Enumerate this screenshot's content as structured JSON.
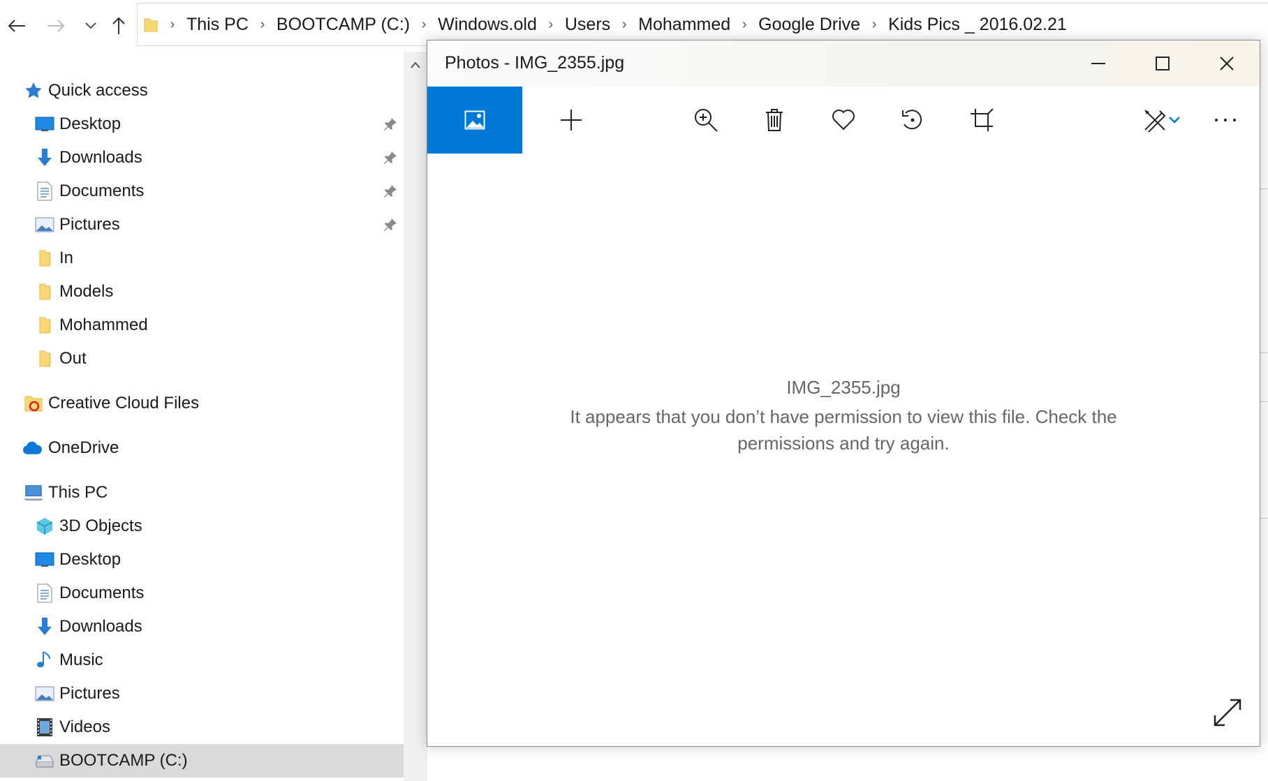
{
  "address_bar": {
    "crumbs": [
      "This PC",
      "BOOTCAMP (C:)",
      "Windows.old",
      "Users",
      "Mohammed",
      "Google Drive",
      "Kids Pics _  2016.02.21"
    ]
  },
  "nav_pane": {
    "quick_access": "Quick access",
    "quick_items": [
      {
        "label": "Desktop",
        "icon": "desktop-icon",
        "pinned": true
      },
      {
        "label": "Downloads",
        "icon": "downloads-icon",
        "pinned": true
      },
      {
        "label": "Documents",
        "icon": "documents-icon",
        "pinned": true
      },
      {
        "label": "Pictures",
        "icon": "pictures-icon",
        "pinned": true
      },
      {
        "label": "In",
        "icon": "folder-icon",
        "pinned": false
      },
      {
        "label": "Models",
        "icon": "folder-icon",
        "pinned": false
      },
      {
        "label": "Mohammed",
        "icon": "folder-icon",
        "pinned": false
      },
      {
        "label": "Out",
        "icon": "folder-icon",
        "pinned": false
      }
    ],
    "creative_cloud": "Creative Cloud Files",
    "onedrive": "OneDrive",
    "this_pc": "This PC",
    "pc_items": [
      {
        "label": "3D Objects",
        "icon": "3d-objects-icon"
      },
      {
        "label": "Desktop",
        "icon": "desktop-icon"
      },
      {
        "label": "Documents",
        "icon": "documents-icon"
      },
      {
        "label": "Downloads",
        "icon": "downloads-icon"
      },
      {
        "label": "Music",
        "icon": "music-icon"
      },
      {
        "label": "Pictures",
        "icon": "pictures-icon"
      },
      {
        "label": "Videos",
        "icon": "videos-icon"
      },
      {
        "label": "BOOTCAMP (C:)",
        "icon": "drive-icon",
        "selected": true
      }
    ]
  },
  "photos": {
    "title": "Photos - IMG_2355.jpg",
    "error_filename": "IMG_2355.jpg",
    "error_message": "It appears that you don’t have permission to view this file. Check the permissions and try again."
  },
  "colors": {
    "accent": "#0078d7",
    "selection": "#d9d9d9",
    "folder": "#f8d775"
  }
}
